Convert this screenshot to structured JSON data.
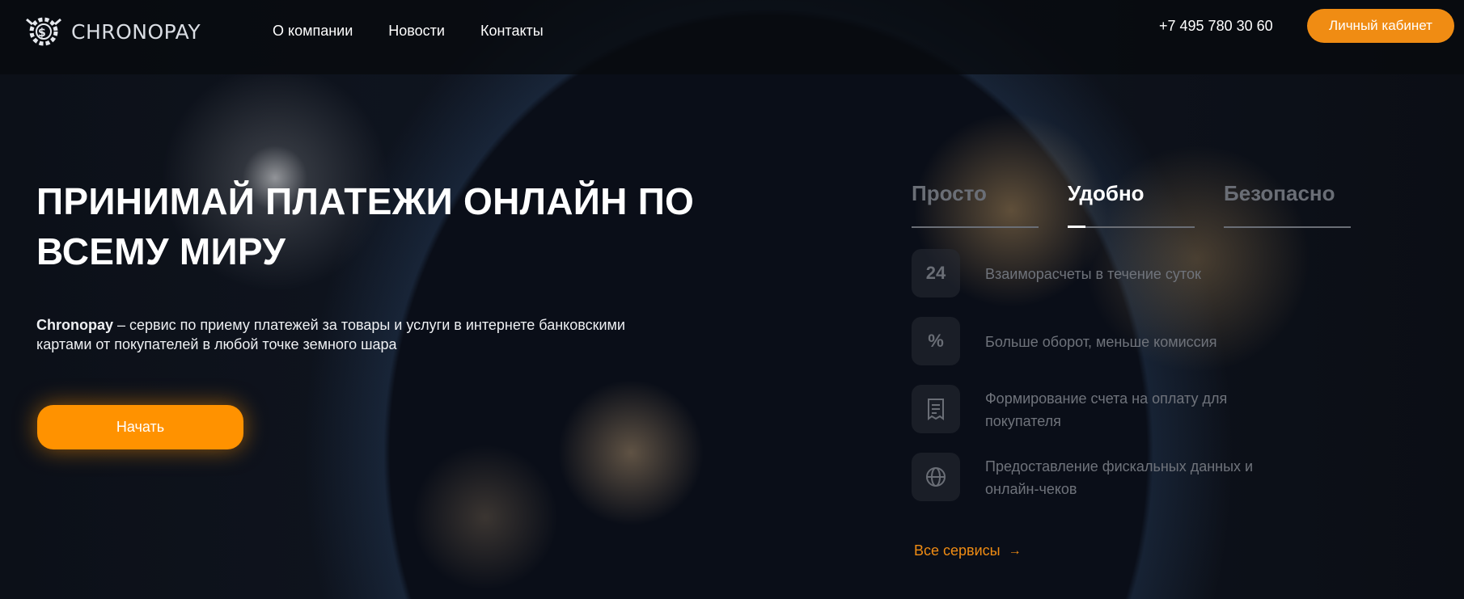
{
  "header": {
    "logo_text": "CHRONOPAY",
    "nav": [
      {
        "label": "О компании"
      },
      {
        "label": "Новости"
      },
      {
        "label": "Контакты"
      }
    ],
    "phone": "+7 495 780 30 60",
    "cabinet_label": "Личный кабинет"
  },
  "hero": {
    "title": "ПРИНИМАЙ ПЛАТЕЖИ ОНЛАЙН ПО ВСЕМУ МИРУ",
    "desc_brand": "Chronopay",
    "desc_text": " – сервис по приему платежей за товары и услуги в интернете банковскими картами от покупателей в любой точке земного шара",
    "start_label": "Начать"
  },
  "tabs": [
    {
      "label": "Просто",
      "active": false
    },
    {
      "label": "Удобно",
      "active": true
    },
    {
      "label": "Безопасно",
      "active": false
    }
  ],
  "features": [
    {
      "icon": "24",
      "icon_name": "clock-24-icon",
      "text": "Взаиморасчеты в течение суток"
    },
    {
      "icon": "%",
      "icon_name": "percent-icon",
      "text": "Больше оборот, меньше комиссия"
    },
    {
      "icon": "receipt",
      "icon_name": "receipt-icon",
      "text": "Формирование счета на оплату для покупателя"
    },
    {
      "icon": "globe",
      "icon_name": "globe-icon",
      "text": "Предоставление фискальных данных и онлайн-чеков"
    }
  ],
  "all_services": "Все сервисы",
  "colors": {
    "accent": "#f08c13",
    "button": "#ff9200",
    "muted": "#6f737b"
  }
}
